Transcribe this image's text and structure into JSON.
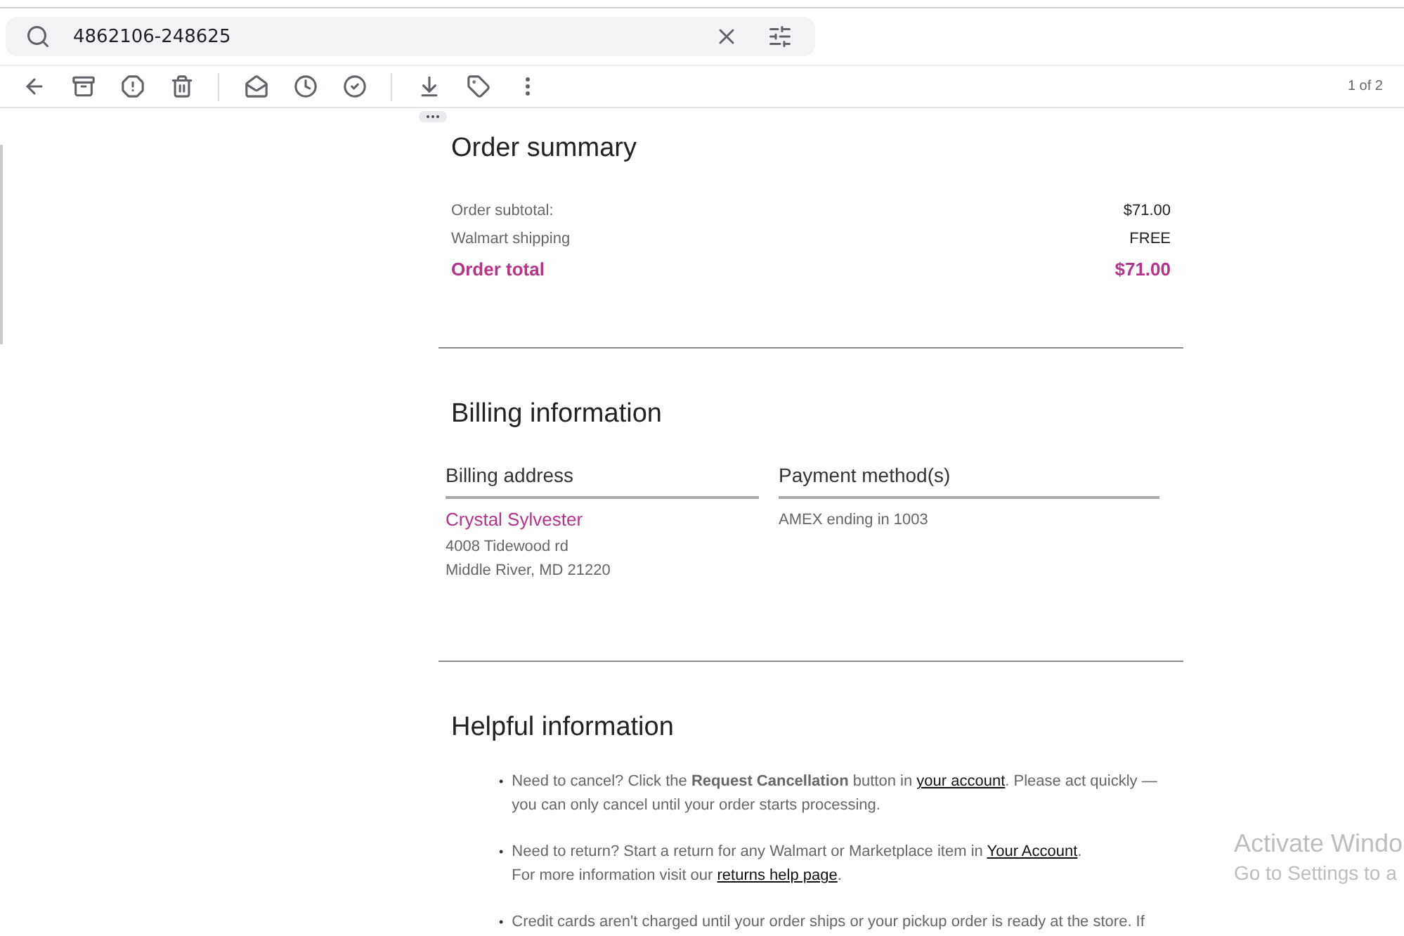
{
  "search": {
    "value": "4862106-248625"
  },
  "toolbar": {
    "pager": "1 of 2"
  },
  "order_summary": {
    "title": "Order summary",
    "rows": [
      {
        "label": "Order subtotal:",
        "value": "$71.00",
        "kind": "line"
      },
      {
        "label": "Walmart shipping",
        "value": "FREE",
        "kind": "line"
      },
      {
        "label": "Order total",
        "value": "$71.00",
        "kind": "total"
      }
    ]
  },
  "billing": {
    "title": "Billing information",
    "address": {
      "heading": "Billing address",
      "name": "Crystal Sylvester",
      "lines": [
        "4008 Tidewood rd",
        "Middle River, MD 21220"
      ]
    },
    "payment": {
      "heading": "Payment method(s)",
      "lines": [
        "AMEX ending in 1003"
      ]
    }
  },
  "helpful": {
    "title": "Helpful information",
    "items": [
      {
        "marker": "•",
        "paragraphs": [
          [
            {
              "kind": "text",
              "text": "Need to cancel? Click the **Request Cancellation** button in "
            },
            {
              "kind": "link",
              "text": "your account"
            },
            {
              "kind": "text",
              "text": ". Please act quickly — you can only cancel until your order starts processing."
            }
          ]
        ]
      },
      {
        "marker": "•",
        "paragraphs": [
          [
            {
              "kind": "text",
              "text": "Need to return? Start a return for any Walmart or Marketplace item in "
            },
            {
              "kind": "link",
              "text": "Your Account"
            },
            {
              "kind": "text",
              "text": "."
            }
          ],
          [
            {
              "kind": "text",
              "text": "For more information visit our "
            },
            {
              "kind": "link",
              "text": "returns help page"
            },
            {
              "kind": "text",
              "text": "."
            }
          ]
        ]
      },
      {
        "marker": "•",
        "paragraphs": [
          [
            {
              "kind": "text",
              "text": "Credit cards aren't charged until your order ships or your pickup order is ready at the store. If"
            }
          ]
        ]
      }
    ]
  },
  "overlay": {
    "title": "Activate Windo",
    "subtitle": "Go to Settings to a"
  }
}
